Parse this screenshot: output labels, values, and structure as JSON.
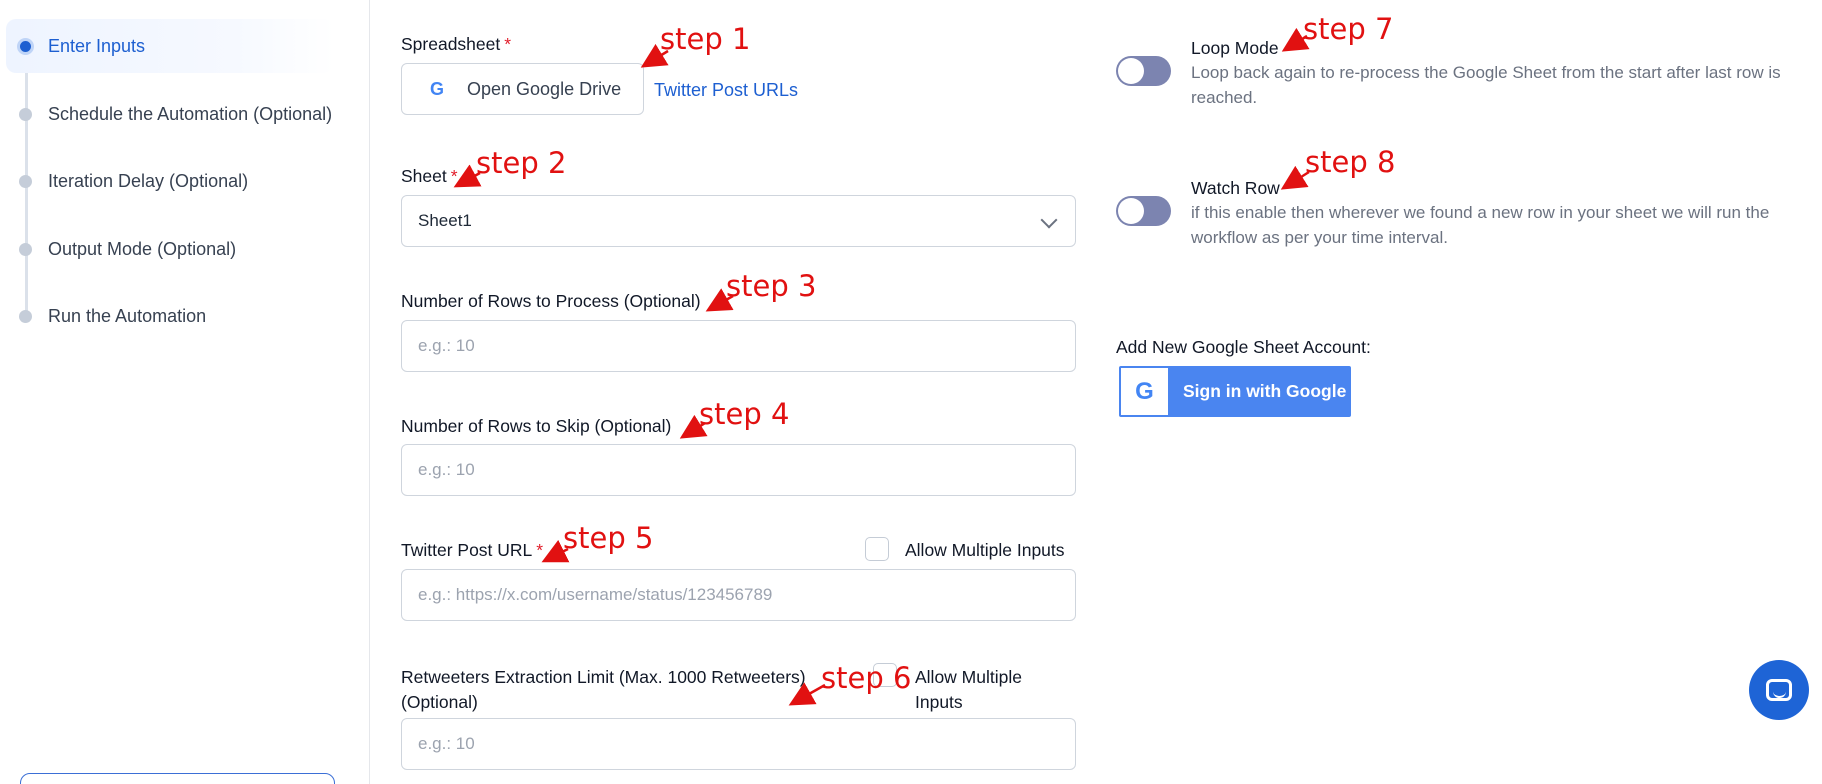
{
  "sidebar": {
    "steps": [
      {
        "label": "Enter Inputs"
      },
      {
        "label": "Schedule the Automation (Optional)"
      },
      {
        "label": "Iteration Delay (Optional)"
      },
      {
        "label": "Output Mode (Optional)"
      },
      {
        "label": "Run the Automation"
      }
    ],
    "active_index": 0
  },
  "form": {
    "spreadsheet": {
      "label": "Spreadsheet",
      "required_mark": "*",
      "drive_icon": "G",
      "drive_button_label": "Open Google Drive",
      "file_link": "Twitter Post URLs"
    },
    "sheet": {
      "label": "Sheet",
      "required_mark": "*",
      "value": "Sheet1"
    },
    "rows_to_process": {
      "label": "Number of Rows to Process (Optional)",
      "placeholder": "e.g.: 10"
    },
    "rows_to_skip": {
      "label": "Number of Rows to Skip (Optional)",
      "placeholder": "e.g.: 10"
    },
    "twitter_post_url": {
      "label": "Twitter Post URL",
      "required_mark": "*",
      "allow_multiple_label": "Allow Multiple Inputs",
      "placeholder": "e.g.: https://x.com/username/status/123456789"
    },
    "retweeters_limit": {
      "label_line1": "Retweeters Extraction Limit (Max. 1000 Retweeters)",
      "label_line2": "(Optional)",
      "allow_multiple_line1": "Allow Multiple",
      "allow_multiple_line2": "Inputs",
      "placeholder": "e.g.: 10"
    }
  },
  "options": {
    "loop_mode": {
      "title": "Loop Mode",
      "description": "Loop back again to re-process the Google Sheet from the start after last row is reached.",
      "enabled": false
    },
    "watch_row": {
      "title": "Watch Row",
      "description": "if this enable then wherever we found a new row in your sheet we will run the workflow as per your time interval.",
      "enabled": false
    },
    "account": {
      "label": "Add New Google Sheet Account:",
      "google_icon": "G",
      "sign_in_label": "Sign in with Google"
    }
  },
  "annotations": [
    "step 1",
    "step 2",
    "step 3",
    "step 4",
    "step 5",
    "step 6",
    "step 7",
    "step 8"
  ],
  "colors": {
    "accent": "#1d5fd1",
    "annotation": "#e11111",
    "toggle": "#7c84b0",
    "google_button": "#4a85f0"
  },
  "icons": {
    "drive_button": "google-g-icon",
    "select": "chevron-down-icon",
    "chat": "chat-icon"
  }
}
